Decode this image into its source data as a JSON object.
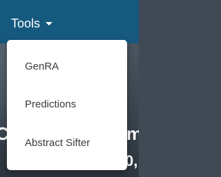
{
  "navbar": {
    "tools_label": "Tools",
    "caret_icon": "caret-down-icon",
    "background_color": "#16597e"
  },
  "dropdown": {
    "items": [
      {
        "label": "GenRA"
      },
      {
        "label": "Predictions"
      },
      {
        "label": "Abstract Sifter"
      }
    ]
  },
  "hero": {
    "fragment_left": "C",
    "fragment_right": "m",
    "fragment_bottom": "0,"
  }
}
